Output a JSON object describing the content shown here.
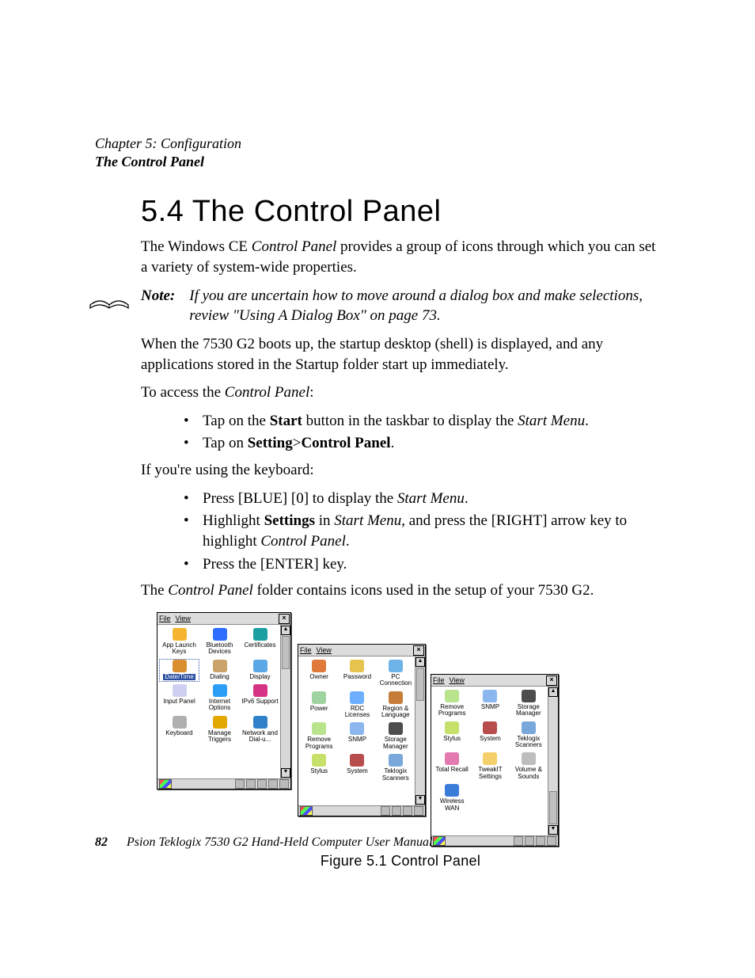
{
  "header": {
    "chapter_line": "Chapter 5: Configuration",
    "section_line": "The Control Panel"
  },
  "title": "5.4  The Control Panel",
  "intro_before": "The Windows CE ",
  "intro_em": "Control Panel",
  "intro_after": " provides a group of icons through which you can set a variety of system-wide properties.",
  "note": {
    "label": "Note:",
    "body": "If you are uncertain how to move around a dialog box and make selections, review \"Using A Dialog Box\" on page 73."
  },
  "p_boot": "When the 7530 G2 boots up, the startup desktop (shell) is displayed, and any applications stored in the Startup folder start up immediately.",
  "p_access_before": "To access the ",
  "p_access_em": "Control Panel",
  "p_access_after": ":",
  "bullets1": {
    "b0_a": "Tap on the ",
    "b0_b": "Start",
    "b0_c": " button in the taskbar to display the ",
    "b0_d": "Start Menu",
    "b0_e": ".",
    "b1_a": "Tap on ",
    "b1_b": "Setting",
    "b1_c": ">",
    "b1_d": "Control Panel",
    "b1_e": "."
  },
  "p_keyboard": "If you're using the keyboard:",
  "bullets2": {
    "b0_a": "Press [BLUE] [0] to display the ",
    "b0_b": "Start Menu",
    "b0_c": ".",
    "b1_a": "Highlight ",
    "b1_b": "Settings",
    "b1_c": " in ",
    "b1_d": "Start Menu",
    "b1_e": ", and press the [RIGHT] arrow key to highlight ",
    "b1_f": "Control Panel",
    "b1_g": ".",
    "b2": "Press the [ENTER] key."
  },
  "p_folder_a": "The ",
  "p_folder_b": "Control Panel",
  "p_folder_c": " folder contains icons used in the setup of your 7530 G2.",
  "figure_caption": "Figure 5.1 Control Panel",
  "menus": {
    "file": "File",
    "view": "View",
    "close": "×"
  },
  "win1": {
    "icons": [
      "App Launch Keys",
      "Bluetooth Devices",
      "Certificates",
      "Date/Time",
      "Dialing",
      "Display",
      "Input Panel",
      "Internet Options",
      "IPv6 Support",
      "Keyboard",
      "Manage Triggers",
      "Network and Dial-u..."
    ],
    "selected": 3
  },
  "win2": {
    "icons": [
      "Owner",
      "Password",
      "PC Connection",
      "Power",
      "RDC Licenses",
      "Region & Language",
      "Remove Programs",
      "SNMP",
      "Storage Manager",
      "Stylus",
      "System",
      "Teklogix Scanners"
    ]
  },
  "win3": {
    "icons": [
      "Remove Programs",
      "SNMP",
      "Storage Manager",
      "Stylus",
      "System",
      "Teklogix Scanners",
      "Total Recall",
      "TweakIT Settings",
      "Volume & Sounds",
      "Wireless WAN"
    ]
  },
  "footer": {
    "page": "82",
    "book": "Psion Teklogix 7530 G2 Hand-Held Computer User Manual"
  }
}
